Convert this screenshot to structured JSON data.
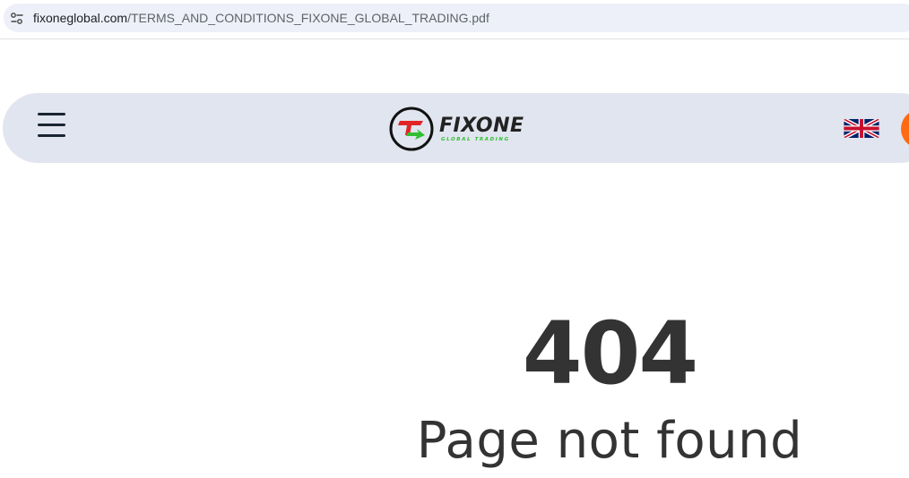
{
  "browser": {
    "url_host": "fixoneglobal.com",
    "url_path": "/TERMS_AND_CONDITIONS_FIXONE_GLOBAL_TRADING.pdf"
  },
  "header": {
    "logo_name": "FIXONE",
    "logo_tagline": "GLOBAL TRADING",
    "language_flag": "uk-flag-icon"
  },
  "colors": {
    "header_bg": "#e1e5ef",
    "accent": "#ff6a13",
    "logo_red": "#e02424",
    "logo_green": "#2fbf2f",
    "text_dark": "#333333"
  },
  "error": {
    "code": "404",
    "message": "Page not found"
  }
}
